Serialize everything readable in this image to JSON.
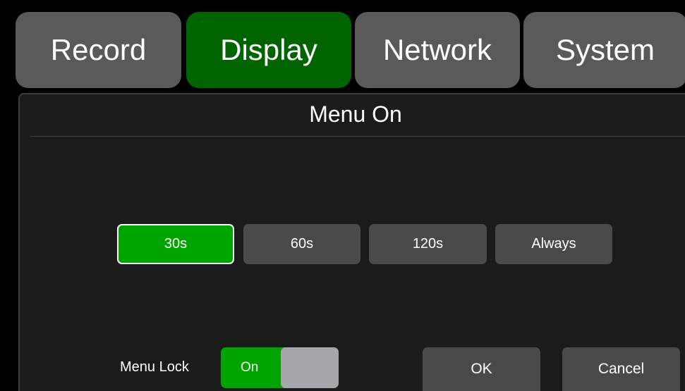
{
  "tabs": [
    {
      "label": "Record",
      "active": false
    },
    {
      "label": "Display",
      "active": true
    },
    {
      "label": "Network",
      "active": false
    },
    {
      "label": "System",
      "active": false
    }
  ],
  "panel": {
    "title": "Menu On",
    "options": [
      {
        "label": "30s",
        "selected": true
      },
      {
        "label": "60s",
        "selected": false
      },
      {
        "label": "120s",
        "selected": false
      },
      {
        "label": "Always",
        "selected": false
      }
    ],
    "menu_lock": {
      "label": "Menu Lock",
      "state": "On"
    },
    "ok_label": "OK",
    "cancel_label": "Cancel"
  },
  "colors": {
    "active_tab": "#006400",
    "selected_option": "#00a400",
    "toggle_on": "#00a400",
    "inactive": "#4a4a4a"
  }
}
